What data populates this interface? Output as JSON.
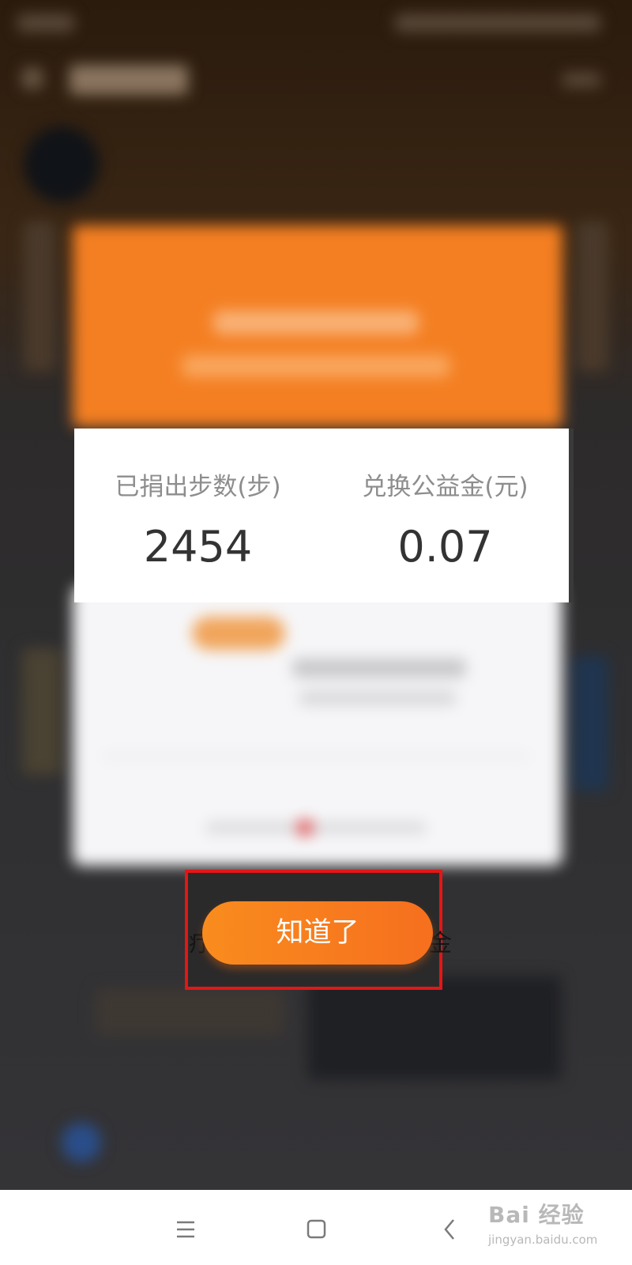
{
  "dialog": {
    "stats": [
      {
        "label": "已捐出步数(步)",
        "value": "2454"
      },
      {
        "label": "兑换公益金(元)",
        "value": "0.07"
      }
    ],
    "confirm_label": "知道了"
  },
  "background_text": {
    "left_fragment": "疗",
    "right_fragment": "金"
  },
  "highlight": {
    "color": "#e41616"
  },
  "accent_color": "#f47f22",
  "system_nav": {
    "icons": [
      "menu-icon",
      "home-icon",
      "back-icon"
    ]
  },
  "watermark": {
    "logo": "Bai 经验",
    "url": "jingyan.baidu.com"
  }
}
